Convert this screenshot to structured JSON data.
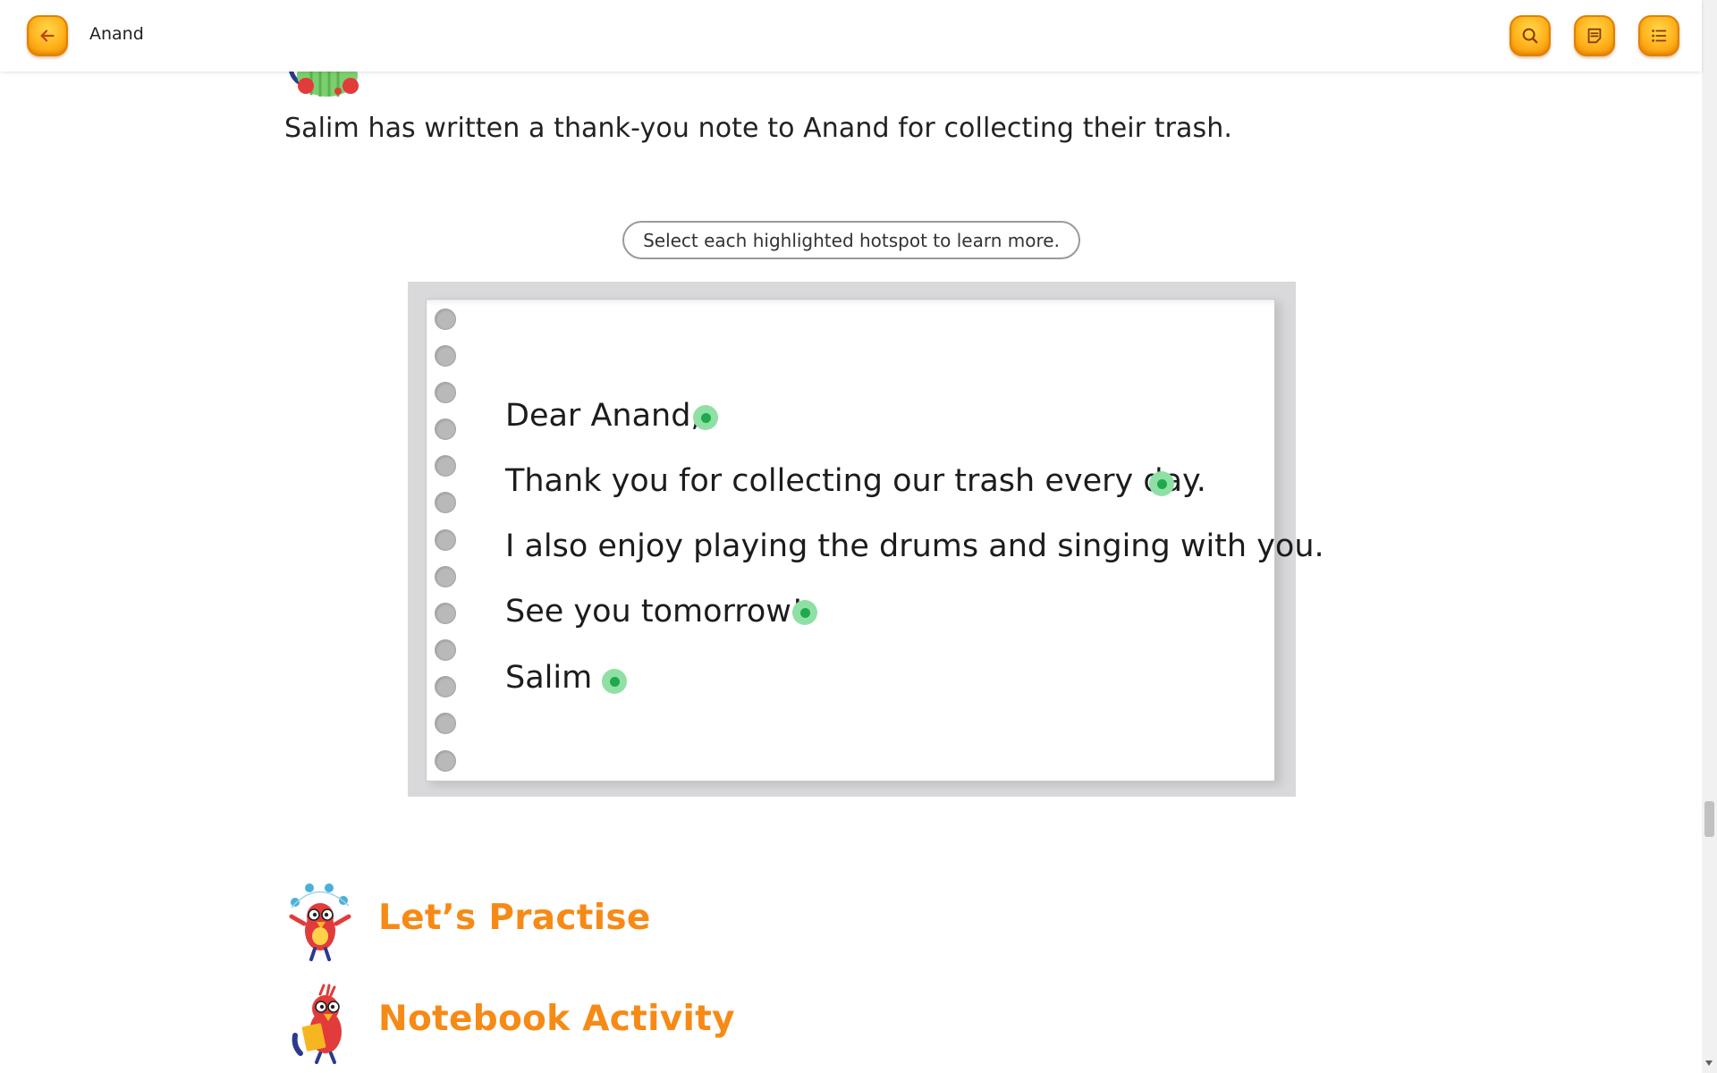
{
  "header": {
    "title": "Anand",
    "back_icon": "arrow-left-icon",
    "search_icon": "search-icon",
    "notes_icon": "notes-icon",
    "toc_icon": "list-icon",
    "accent_color": "#ffb21c"
  },
  "content": {
    "intro": "Salim has written a thank-you note to Anand for collecting their trash.",
    "hint": "Select each highlighted hotspot to learn more.",
    "note_lines": [
      "Dear Anand,",
      "Thank you for collecting our trash every day.",
      "I also enjoy playing the drums and singing with you.",
      "See you tomorrow!",
      "Salim"
    ],
    "hotspot_color": "#1fa94c"
  },
  "sections": [
    {
      "title": "Let’s Practise",
      "icon": "juggling-parrot-mascot"
    },
    {
      "title": "Notebook Activity",
      "icon": "notebook-parrot-mascot"
    }
  ],
  "section_title_color": "#f68a16"
}
